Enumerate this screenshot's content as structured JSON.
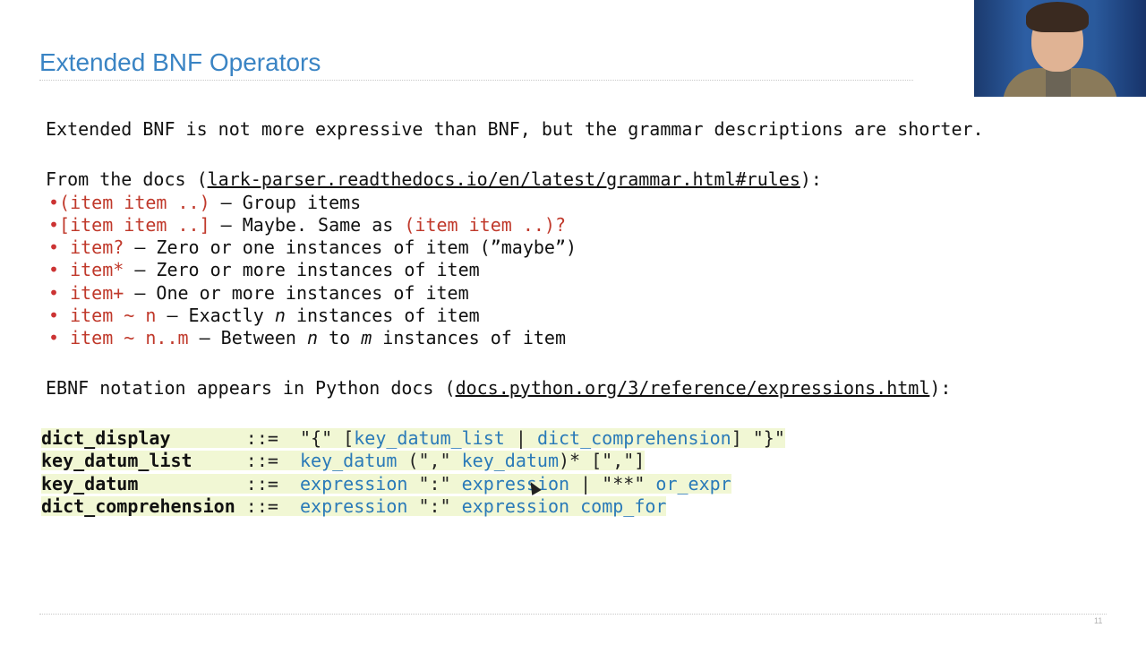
{
  "slide": {
    "title": "Extended BNF Operators",
    "page_number": "11"
  },
  "intro": "Extended BNF is not more expressive than BNF, but the grammar descriptions are shorter.",
  "docs_line": {
    "prefix": "From the docs (",
    "link": "lark-parser.readthedocs.io/en/latest/grammar.html#rules",
    "suffix": "):"
  },
  "bullets": [
    {
      "marker": "•",
      "code": "(item item ..)",
      "text": " – Group items",
      "extra": ""
    },
    {
      "marker": "•",
      "code": "[item item ..]",
      "text": " – Maybe. Same as ",
      "extra": "(item item ..)?"
    },
    {
      "marker": "•",
      "code": " item?",
      "text": " – Zero or one instances of item (”maybe”)",
      "extra": ""
    },
    {
      "marker": "•",
      "code": " item*",
      "text": " – Zero or more instances of item",
      "extra": ""
    },
    {
      "marker": "•",
      "code": " item+",
      "text": " – One or more instances of item",
      "extra": ""
    },
    {
      "marker": "•",
      "code": " item ~ n",
      "text": " – Exactly ",
      "italic": "n",
      "text2": " instances of item"
    },
    {
      "marker": "•",
      "code": " item ~ n..m",
      "text": " – Between ",
      "italic": "n",
      "text2": " to ",
      "italic2": "m",
      "text3": " instances of item"
    }
  ],
  "python_line": {
    "prefix": "EBNF notation appears in Python docs (",
    "link": "docs.python.org/3/reference/expressions.html",
    "suffix": "):"
  },
  "grammar": [
    {
      "name": "dict_display",
      "op": "::=",
      "rhs": [
        {
          "t": "\"{\" [",
          "c": "dark"
        },
        {
          "t": "key_datum_list",
          "c": "blue"
        },
        {
          "t": " | ",
          "c": "dark"
        },
        {
          "t": "dict_comprehension",
          "c": "blue"
        },
        {
          "t": "] \"}\"",
          "c": "dark"
        }
      ]
    },
    {
      "name": "key_datum_list",
      "op": "::=",
      "rhs": [
        {
          "t": "key_datum",
          "c": "blue"
        },
        {
          "t": " (\",\" ",
          "c": "dark"
        },
        {
          "t": "key_datum",
          "c": "blue"
        },
        {
          "t": ")* [\",\"]",
          "c": "dark"
        }
      ]
    },
    {
      "name": "key_datum",
      "op": "::=",
      "rhs": [
        {
          "t": "expression",
          "c": "blue"
        },
        {
          "t": " \":\" ",
          "c": "dark"
        },
        {
          "t": "expression",
          "c": "blue"
        },
        {
          "t": " | \"**\" ",
          "c": "dark"
        },
        {
          "t": "or_expr",
          "c": "blue"
        }
      ]
    },
    {
      "name": "dict_comprehension",
      "op": "::=",
      "rhs": [
        {
          "t": "expression",
          "c": "blue"
        },
        {
          "t": " \":\" ",
          "c": "dark"
        },
        {
          "t": "expression",
          "c": "blue"
        },
        {
          "t": " ",
          "c": "dark"
        },
        {
          "t": "comp_for",
          "c": "blue"
        }
      ]
    }
  ],
  "colors": {
    "title": "#3a84c4",
    "code_red": "#c0392b",
    "grammar_blue": "#2a7ab8",
    "highlight": "#f1f7d4"
  }
}
